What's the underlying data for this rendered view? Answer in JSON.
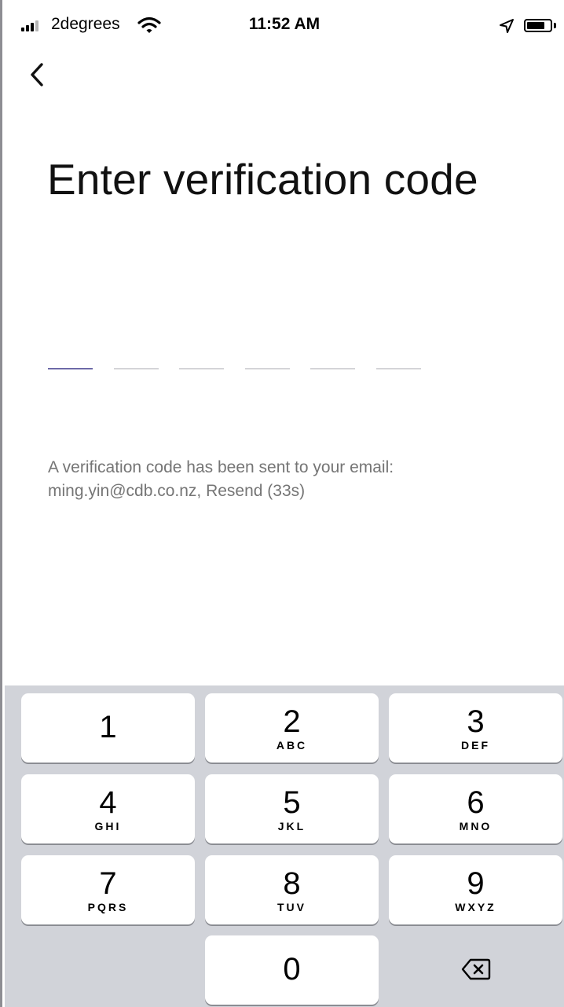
{
  "status_bar": {
    "carrier": "2degrees",
    "time": "11:52 AM"
  },
  "page": {
    "title": "Enter verification code",
    "code_slot_count": 6,
    "code_value": [
      "",
      "",
      "",
      "",
      "",
      ""
    ],
    "active_slot": 1,
    "info_text": "A verification code has been sent to your email:",
    "email": "ming.yin@cdb.co.nz",
    "separator": ", ",
    "resend_label": "Resend (33s)"
  },
  "keypad": {
    "keys": [
      {
        "num": "1",
        "letters": ""
      },
      {
        "num": "2",
        "letters": "ABC"
      },
      {
        "num": "3",
        "letters": "DEF"
      },
      {
        "num": "4",
        "letters": "GHI"
      },
      {
        "num": "5",
        "letters": "JKL"
      },
      {
        "num": "6",
        "letters": "MNO"
      },
      {
        "num": "7",
        "letters": "PQRS"
      },
      {
        "num": "8",
        "letters": "TUV"
      },
      {
        "num": "9",
        "letters": "WXYZ"
      },
      {
        "num": "0",
        "letters": ""
      }
    ],
    "delete_icon": "backspace-icon"
  },
  "colors": {
    "active_underline": "#6d6aa8",
    "inactive_underline": "#d4d4d8",
    "keypad_background": "#d1d3d9",
    "info_text": "#757575"
  },
  "icons": {
    "signal": "signal-bars-icon",
    "wifi": "wifi-icon",
    "location": "location-arrow-icon",
    "battery": "battery-icon",
    "back": "chevron-left-icon"
  }
}
